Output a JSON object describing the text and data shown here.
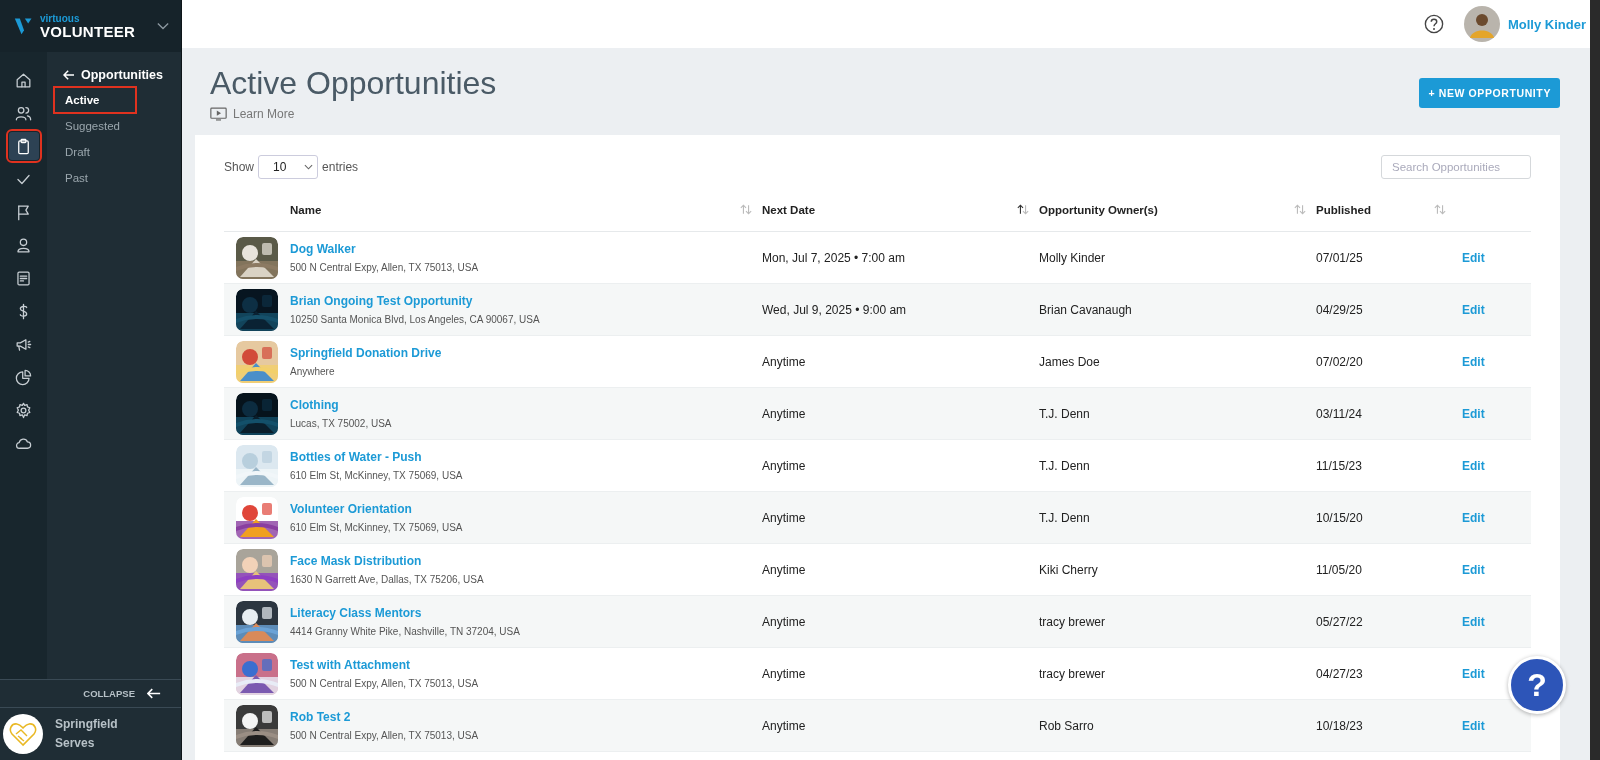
{
  "brand": {
    "small": "virtuous",
    "large": "VOLUNTEER"
  },
  "rail": [
    {
      "selected": false,
      "highlighted": false
    },
    {
      "selected": false,
      "highlighted": false
    },
    {
      "selected": true,
      "highlighted": true
    },
    {
      "selected": false,
      "highlighted": false
    },
    {
      "selected": false,
      "highlighted": false
    },
    {
      "selected": false,
      "highlighted": false
    },
    {
      "selected": false,
      "highlighted": false
    },
    {
      "selected": false,
      "highlighted": false
    },
    {
      "selected": false,
      "highlighted": false
    },
    {
      "selected": false,
      "highlighted": false
    },
    {
      "selected": false,
      "highlighted": false
    },
    {
      "selected": false,
      "highlighted": false
    }
  ],
  "subnav": {
    "title": "Opportunities",
    "items": [
      {
        "label": "Active",
        "selected": true,
        "highlighted": true
      },
      {
        "label": "Suggested",
        "selected": false,
        "highlighted": false
      },
      {
        "label": "Draft",
        "selected": false,
        "highlighted": false
      },
      {
        "label": "Past",
        "selected": false,
        "highlighted": false
      }
    ]
  },
  "collapse": "COLLAPSE",
  "org": {
    "name": "Springfield Serves"
  },
  "user": {
    "name": "Molly Kinder"
  },
  "page": {
    "title": "Active Opportunities",
    "learn_more": "Learn More",
    "new_button": "+ NEW OPPORTUNITY"
  },
  "table": {
    "show_label": "Show",
    "page_size": "10",
    "entries_label": "entries",
    "search_placeholder": "Search Opportunities",
    "columns": [
      {
        "label": "Name",
        "sorted": false
      },
      {
        "label": "Next Date",
        "sorted": true
      },
      {
        "label": "Opportunity Owner(s)",
        "sorted": false
      },
      {
        "label": "Published",
        "sorted": false
      }
    ],
    "rows": [
      {
        "name": "Dog Walker",
        "address": "500 N Central Expy, Allen, TX 75013, USA",
        "next_date": "Mon, Jul 7, 2025 • 7:00 am",
        "owner": "Molly Kinder",
        "published": "07/01/25",
        "action": "Edit"
      },
      {
        "name": "Brian Ongoing Test Opportunity",
        "address": "10250 Santa Monica Blvd, Los Angeles, CA 90067, USA",
        "next_date": "Wed, Jul 9, 2025 • 9:00 am",
        "owner": "Brian Cavanaugh",
        "published": "04/29/25",
        "action": "Edit"
      },
      {
        "name": "Springfield Donation Drive",
        "address": "Anywhere",
        "next_date": "Anytime",
        "owner": "James Doe",
        "published": "07/02/20",
        "action": "Edit"
      },
      {
        "name": "Clothing",
        "address": "Lucas, TX 75002, USA",
        "next_date": "Anytime",
        "owner": "T.J. Denn",
        "published": "03/11/24",
        "action": "Edit"
      },
      {
        "name": "Bottles of Water - Push",
        "address": "610 Elm St, McKinney, TX 75069, USA",
        "next_date": "Anytime",
        "owner": "T.J. Denn",
        "published": "11/15/23",
        "action": "Edit"
      },
      {
        "name": "Volunteer Orientation",
        "address": "610 Elm St, McKinney, TX 75069, USA",
        "next_date": "Anytime",
        "owner": "T.J. Denn",
        "published": "10/15/20",
        "action": "Edit"
      },
      {
        "name": "Face Mask Distribution",
        "address": "1630 N Garrett Ave, Dallas, TX 75206, USA",
        "next_date": "Anytime",
        "owner": "Kiki Cherry",
        "published": "11/05/20",
        "action": "Edit"
      },
      {
        "name": "Literacy Class Mentors",
        "address": "4414 Granny White Pike, Nashville, TN 37204, USA",
        "next_date": "Anytime",
        "owner": "tracy brewer",
        "published": "05/27/22",
        "action": "Edit"
      },
      {
        "name": "Test with Attachment",
        "address": "500 N Central Expy, Allen, TX 75013, USA",
        "next_date": "Anytime",
        "owner": "tracy brewer",
        "published": "04/27/23",
        "action": "Edit"
      },
      {
        "name": "Rob Test 2",
        "address": "500 N Central Expy, Allen, TX 75013, USA",
        "next_date": "Anytime",
        "owner": "Rob Sarro",
        "published": "10/18/23",
        "action": "Edit"
      }
    ]
  },
  "help_button": "?"
}
